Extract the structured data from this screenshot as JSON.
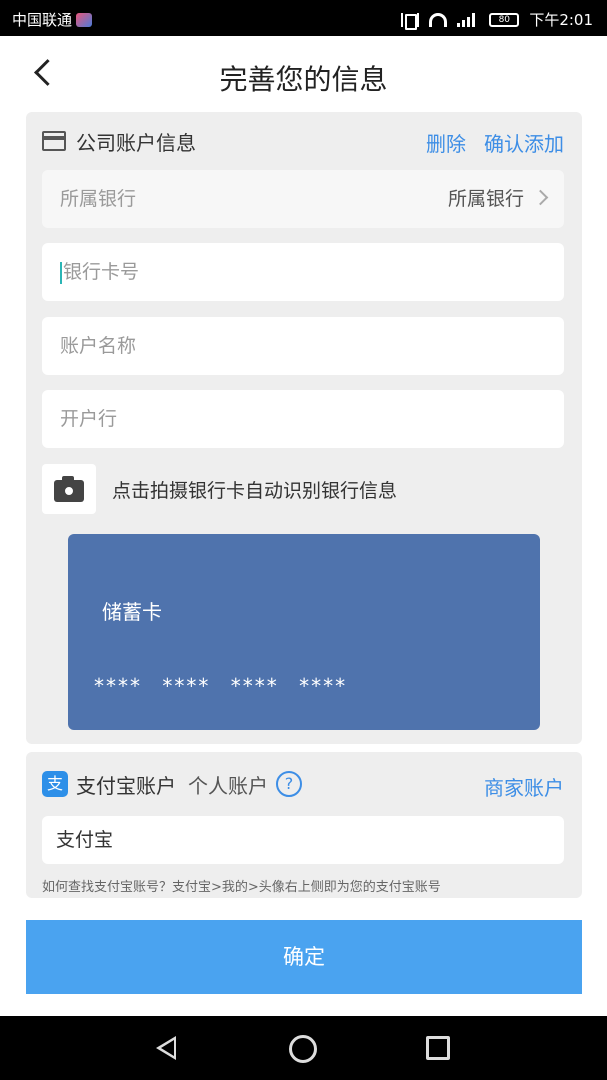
{
  "status_bar": {
    "carrier": "中国联通",
    "battery": "80",
    "time": "下午2:01"
  },
  "header": {
    "title": "完善您的信息"
  },
  "company_account": {
    "title": "公司账户信息",
    "delete_label": "删除",
    "confirm_add_label": "确认添加",
    "bank_field": {
      "placeholder": "所属银行",
      "value": "所属银行"
    },
    "card_number_field": {
      "placeholder": "银行卡号"
    },
    "account_name_field": {
      "placeholder": "账户名称"
    },
    "opening_bank_field": {
      "placeholder": "开户行"
    },
    "scan_hint": "点击拍摄银行卡自动识别银行信息",
    "card_preview": {
      "type": "储蓄卡",
      "number": "**** **** **** ****",
      "color": "#4f73ad"
    }
  },
  "alipay": {
    "icon_text": "支",
    "title": "支付宝账户",
    "personal_label": "个人账户",
    "help_symbol": "?",
    "merchant_label": "商家账户",
    "input_value": "支付宝",
    "hint": "如何查找支付宝账号？支付宝>我的>头像右上侧即为您的支付宝账号"
  },
  "confirm_button": {
    "label": "确定",
    "color": "#4aa3f0"
  },
  "colors": {
    "accent": "#3d8ee6",
    "section_bg": "#eeeeee"
  }
}
